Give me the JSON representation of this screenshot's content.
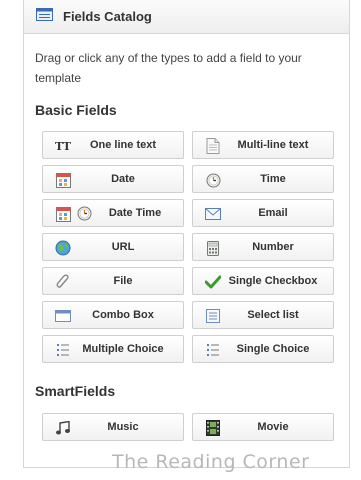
{
  "panel": {
    "title": "Fields Catalog",
    "description": "Drag or click any of the types to add a field to your template",
    "basic_section": "Basic Fields",
    "smart_section": "SmartFields",
    "basic_fields": [
      {
        "label": "One line text",
        "icon": "tt-text-icon"
      },
      {
        "label": "Multi-line text",
        "icon": "document-icon"
      },
      {
        "label": "Date",
        "icon": "calendar-icon"
      },
      {
        "label": "Time",
        "icon": "clock-icon"
      },
      {
        "label": "Date Time",
        "icon": "calendar-clock-icon"
      },
      {
        "label": "Email",
        "icon": "envelope-icon"
      },
      {
        "label": "URL",
        "icon": "globe-icon"
      },
      {
        "label": "Number",
        "icon": "calculator-icon"
      },
      {
        "label": "File",
        "icon": "paperclip-icon"
      },
      {
        "label": "Single Checkbox",
        "icon": "checkmark-icon"
      },
      {
        "label": "Combo Box",
        "icon": "combo-box-icon"
      },
      {
        "label": "Select list",
        "icon": "list-box-icon"
      },
      {
        "label": "Multiple Choice",
        "icon": "bullet-list-icon"
      },
      {
        "label": "Single Choice",
        "icon": "bullet-list-icon"
      }
    ],
    "smart_fields": [
      {
        "label": "Music",
        "icon": "music-note-icon"
      },
      {
        "label": "Movie",
        "icon": "film-strip-icon"
      }
    ]
  },
  "watermark": "The Reading Corner"
}
